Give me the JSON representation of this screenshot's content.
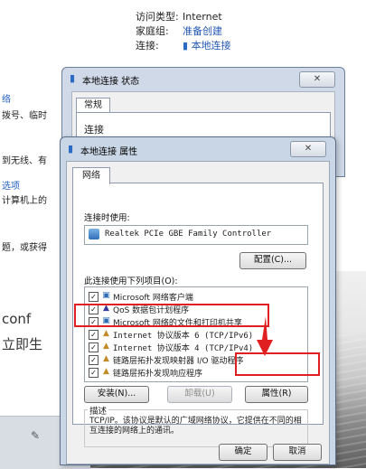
{
  "background": {
    "access_type_label": "访问类型:",
    "access_type_value": "Internet",
    "homegroup_label": "家庭组:",
    "homegroup_value": "准备创建",
    "connection_label": "连接:",
    "connection_value": "本地连接",
    "left_texts": [
      "络",
      "拨号、临时",
      "到无线、有",
      "选项",
      "计算机上的",
      "题，或获得",
      "conf",
      "立即生"
    ]
  },
  "status_window": {
    "title": "本地连接 状态",
    "tab": "常规",
    "section": "连接"
  },
  "properties": {
    "title": "本地连接 属性",
    "tab": "网络",
    "connect_using_label": "连接时使用:",
    "adapter": "Realtek PCIe GBE Family Controller",
    "configure_button": "配置(C)...",
    "items_label": "此连接使用下列项目(O):",
    "items": [
      {
        "checked": true,
        "icon": "network-client-icon",
        "label": "Microsoft 网络客户端"
      },
      {
        "checked": true,
        "icon": "qos-icon",
        "label": "QoS 数据包计划程序"
      },
      {
        "checked": true,
        "icon": "file-share-icon",
        "label": "Microsoft 网络的文件和打印机共享"
      },
      {
        "checked": true,
        "icon": "protocol-icon",
        "label": "Internet 协议版本 6 (TCP/IPv6)"
      },
      {
        "checked": true,
        "icon": "protocol-icon",
        "label": "Internet 协议版本 4 (TCP/IPv4)"
      },
      {
        "checked": true,
        "icon": "protocol-icon",
        "label": "链路层拓扑发现映射器 I/O 驱动程序"
      },
      {
        "checked": true,
        "icon": "protocol-icon",
        "label": "链路层拓扑发现响应程序"
      }
    ],
    "install_button": "安装(N)...",
    "uninstall_button": "卸载(U)",
    "properties_button": "属性(R)",
    "description_title": "描述",
    "description_text": "TCP/IP。该协议是默认的广域网络协议，它提供在不同的相互连接的网络上的通讯。",
    "ok_button": "确定",
    "cancel_button": "取消",
    "close_glyph": "✕"
  },
  "colors": {
    "highlight": "#e02020",
    "link_blue": "#2458b3"
  }
}
